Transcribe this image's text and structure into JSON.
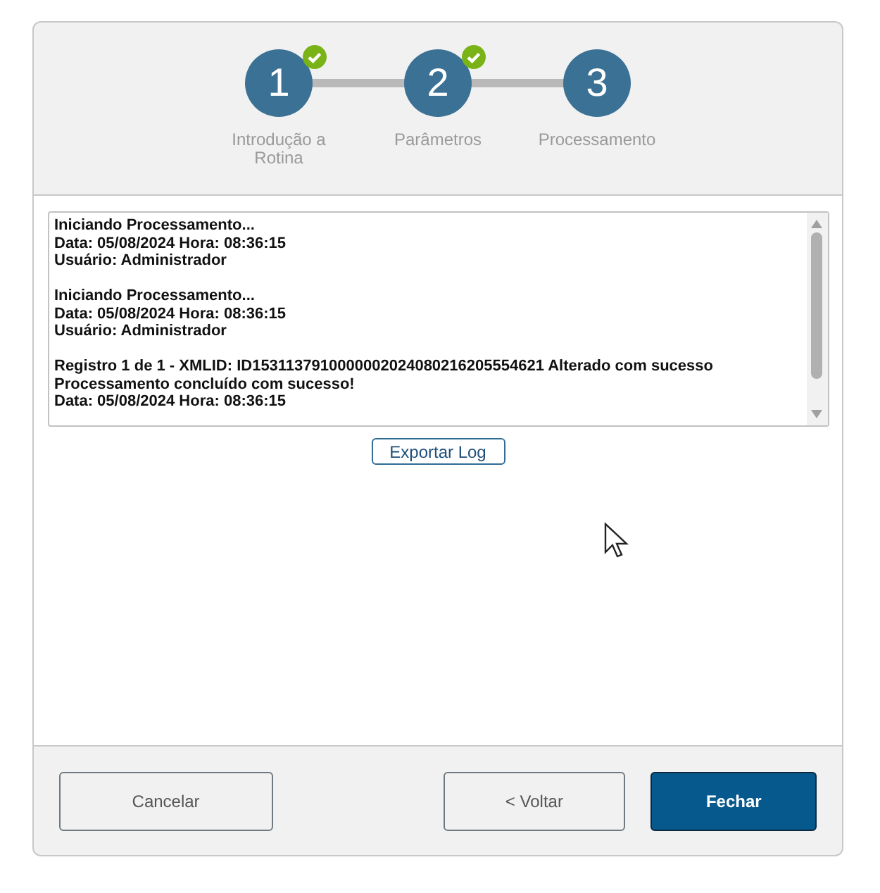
{
  "steps": [
    {
      "number": "1",
      "label": "Introdução a Rotina",
      "completed": true
    },
    {
      "number": "2",
      "label": "Parâmetros",
      "completed": true
    },
    {
      "number": "3",
      "label": "Processamento",
      "completed": false
    }
  ],
  "log": {
    "groups": [
      [
        "Iniciando Processamento...",
        "Data: 05/08/2024 Hora: 08:36:15",
        "Usuário: Administrador"
      ],
      [
        "Iniciando Processamento...",
        "Data: 05/08/2024 Hora: 08:36:15",
        "Usuário: Administrador"
      ],
      [
        "Registro 1 de 1 - XMLID: ID1531137910000002024080216205554621 Alterado com sucesso",
        "Processamento concluído com sucesso!",
        "Data: 05/08/2024 Hora: 08:36:15"
      ]
    ],
    "export_button": "Exportar Log"
  },
  "footer": {
    "buttons": [
      {
        "label": "Cancelar",
        "kind": "default"
      },
      {
        "label": "< Voltar",
        "kind": "default"
      },
      {
        "label": "Fechar",
        "kind": "primary"
      }
    ]
  }
}
